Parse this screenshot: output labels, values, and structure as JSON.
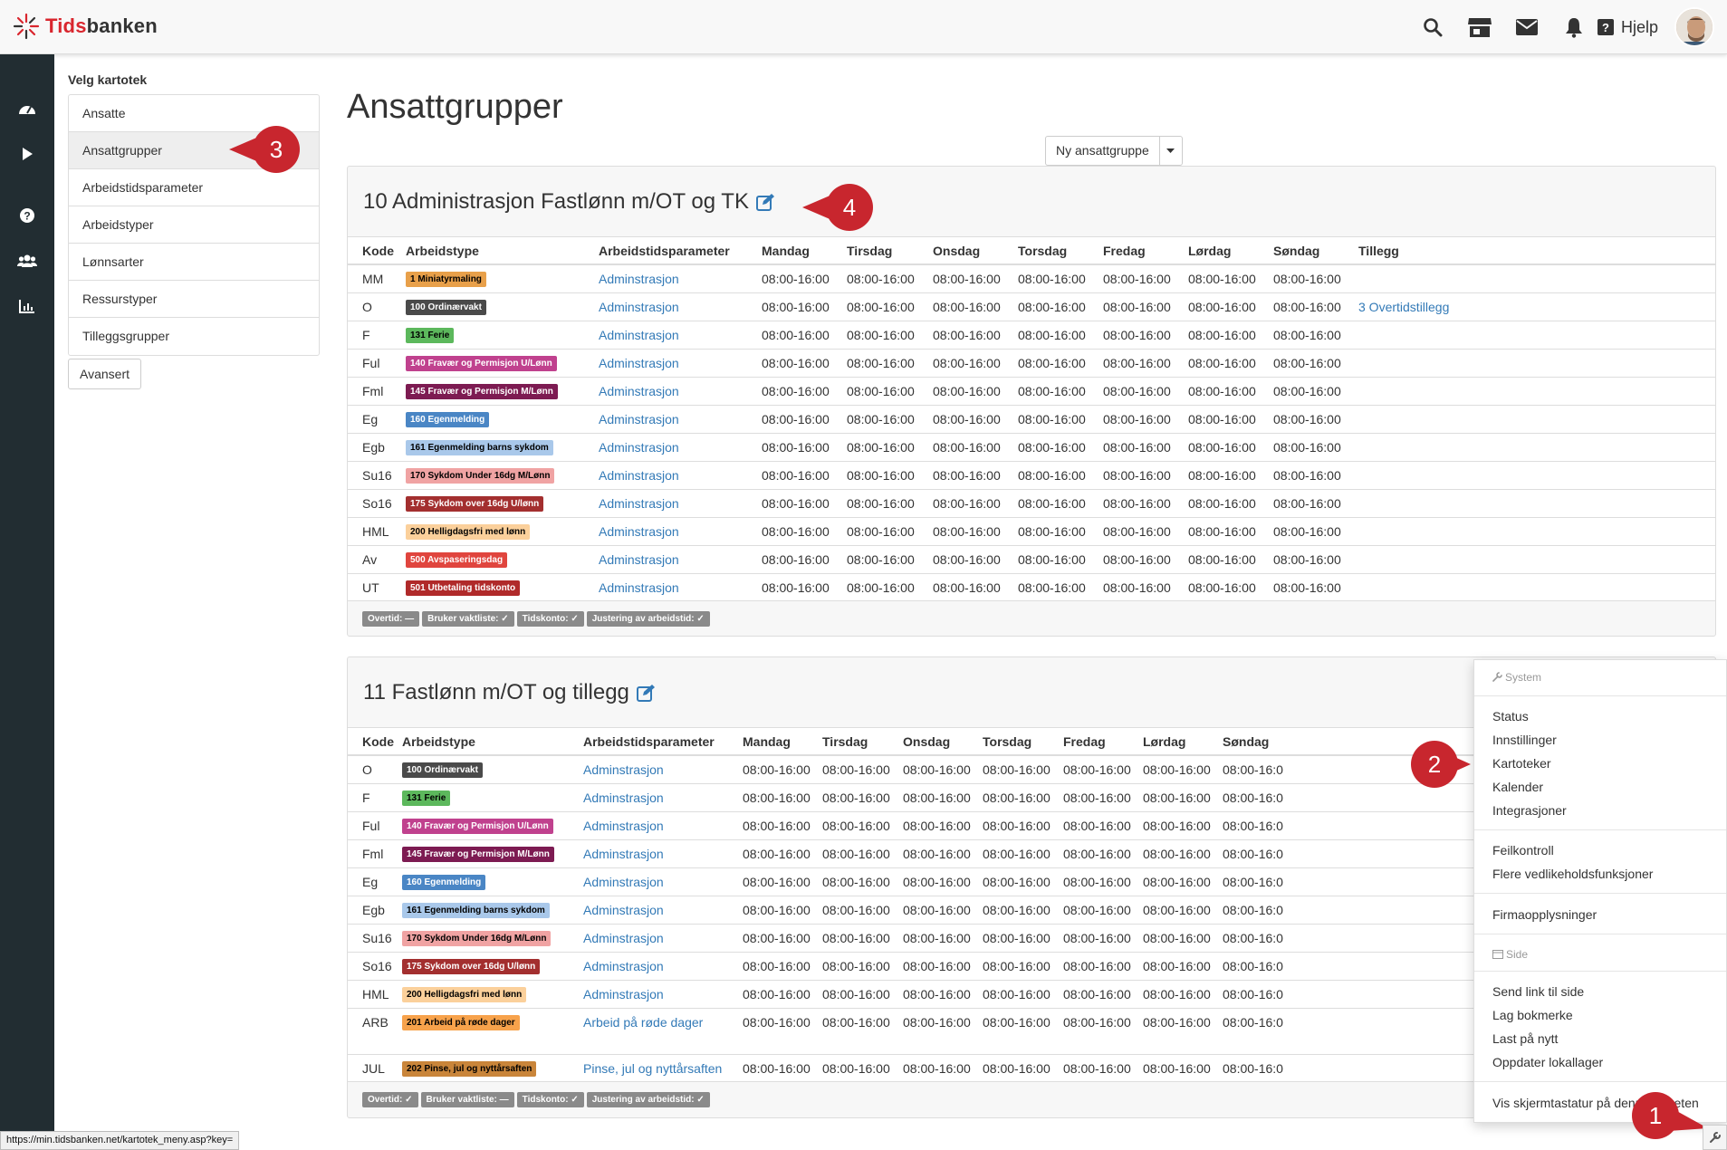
{
  "app": {
    "logo_prefix": "Tids",
    "logo_suffix": "banken"
  },
  "topbar": {
    "help_label": "Hjelp",
    "icons": [
      "search-icon",
      "store-icon",
      "mail-icon",
      "bell-icon",
      "question-icon"
    ]
  },
  "leftrail": {
    "icons": [
      "dashboard-icon",
      "play-icon",
      "help-circle-icon",
      "users-icon",
      "chart-icon"
    ]
  },
  "sidepanel": {
    "title": "Velg kartotek",
    "items": [
      "Ansatte",
      "Ansattgrupper",
      "Arbeidstidsparameter",
      "Arbeidstyper",
      "Lønnsarter",
      "Ressurstyper",
      "Tilleggsgrupper"
    ],
    "active_index": 1,
    "advanced_label": "Avansert"
  },
  "page": {
    "title": "Ansattgrupper",
    "new_button": "Ny ansattgruppe"
  },
  "headers": [
    "Kode",
    "Arbeidstype",
    "Arbeidstidsparameter",
    "Mandag",
    "Tirsdag",
    "Onsdag",
    "Torsdag",
    "Fredag",
    "Lørdag",
    "Søndag",
    "Tillegg"
  ],
  "groups": [
    {
      "title": "10 Administrasjon Fastlønn m/OT og TK",
      "rows": [
        {
          "kode": "MM",
          "type": "1 Miniatyrmaling",
          "color": "#e8a04a",
          "text": "#000",
          "param": "Adminstrasjon",
          "times": [
            "08:00-16:00",
            "08:00-16:00",
            "08:00-16:00",
            "08:00-16:00",
            "08:00-16:00",
            "08:00-16:00",
            "08:00-16:00"
          ],
          "tillegg": ""
        },
        {
          "kode": "O",
          "type": "100 Ordinærvakt",
          "color": "#4a4a4a",
          "text": "#fff",
          "param": "Adminstrasjon",
          "times": [
            "08:00-16:00",
            "08:00-16:00",
            "08:00-16:00",
            "08:00-16:00",
            "08:00-16:00",
            "08:00-16:00",
            "08:00-16:00"
          ],
          "tillegg": "3 Overtidstillegg"
        },
        {
          "kode": "F",
          "type": "131 Ferie",
          "color": "#5cb85c",
          "text": "#000",
          "param": "Adminstrasjon",
          "times": [
            "08:00-16:00",
            "08:00-16:00",
            "08:00-16:00",
            "08:00-16:00",
            "08:00-16:00",
            "08:00-16:00",
            "08:00-16:00"
          ],
          "tillegg": ""
        },
        {
          "kode": "Ful",
          "type": "140 Fravær og Permisjon U/Lønn",
          "color": "#c0418e",
          "text": "#fff",
          "param": "Adminstrasjon",
          "times": [
            "08:00-16:00",
            "08:00-16:00",
            "08:00-16:00",
            "08:00-16:00",
            "08:00-16:00",
            "08:00-16:00",
            "08:00-16:00"
          ],
          "tillegg": ""
        },
        {
          "kode": "Fml",
          "type": "145 Fravær og Permisjon M/Lønn",
          "color": "#7d1b52",
          "text": "#fff",
          "param": "Adminstrasjon",
          "times": [
            "08:00-16:00",
            "08:00-16:00",
            "08:00-16:00",
            "08:00-16:00",
            "08:00-16:00",
            "08:00-16:00",
            "08:00-16:00"
          ],
          "tillegg": ""
        },
        {
          "kode": "Eg",
          "type": "160 Egenmelding",
          "color": "#4a86c5",
          "text": "#fff",
          "param": "Adminstrasjon",
          "times": [
            "08:00-16:00",
            "08:00-16:00",
            "08:00-16:00",
            "08:00-16:00",
            "08:00-16:00",
            "08:00-16:00",
            "08:00-16:00"
          ],
          "tillegg": ""
        },
        {
          "kode": "Egb",
          "type": "161 Egenmelding barns sykdom",
          "color": "#a9c8ea",
          "text": "#000",
          "param": "Adminstrasjon",
          "times": [
            "08:00-16:00",
            "08:00-16:00",
            "08:00-16:00",
            "08:00-16:00",
            "08:00-16:00",
            "08:00-16:00",
            "08:00-16:00"
          ],
          "tillegg": ""
        },
        {
          "kode": "Su16",
          "type": "170 Sykdom Under 16dg M/Lønn",
          "color": "#f0a3a3",
          "text": "#000",
          "param": "Adminstrasjon",
          "times": [
            "08:00-16:00",
            "08:00-16:00",
            "08:00-16:00",
            "08:00-16:00",
            "08:00-16:00",
            "08:00-16:00",
            "08:00-16:00"
          ],
          "tillegg": ""
        },
        {
          "kode": "So16",
          "type": "175 Sykdom over 16dg U/lønn",
          "color": "#a32f2f",
          "text": "#fff",
          "param": "Adminstrasjon",
          "times": [
            "08:00-16:00",
            "08:00-16:00",
            "08:00-16:00",
            "08:00-16:00",
            "08:00-16:00",
            "08:00-16:00",
            "08:00-16:00"
          ],
          "tillegg": ""
        },
        {
          "kode": "HML",
          "type": "200 Helligdagsfri med lønn",
          "color": "#fbd09b",
          "text": "#000",
          "param": "Adminstrasjon",
          "times": [
            "08:00-16:00",
            "08:00-16:00",
            "08:00-16:00",
            "08:00-16:00",
            "08:00-16:00",
            "08:00-16:00",
            "08:00-16:00"
          ],
          "tillegg": ""
        },
        {
          "kode": "Av",
          "type": "500 Avspaseringsdag",
          "color": "#e0453e",
          "text": "#fff",
          "param": "Adminstrasjon",
          "times": [
            "08:00-16:00",
            "08:00-16:00",
            "08:00-16:00",
            "08:00-16:00",
            "08:00-16:00",
            "08:00-16:00",
            "08:00-16:00"
          ],
          "tillegg": ""
        },
        {
          "kode": "UT",
          "type": "501 Utbetaling tidskonto",
          "color": "#b02a2a",
          "text": "#fff",
          "param": "Adminstrasjon",
          "times": [
            "08:00-16:00",
            "08:00-16:00",
            "08:00-16:00",
            "08:00-16:00",
            "08:00-16:00",
            "08:00-16:00",
            "08:00-16:00"
          ],
          "tillegg": ""
        }
      ],
      "footer": [
        "Overtid: —",
        "Bruker vaktliste: ✓",
        "Tidskonto: ✓",
        "Justering av arbeidstid: ✓"
      ]
    },
    {
      "title": "11 Fastlønn m/OT og tillegg",
      "rows": [
        {
          "kode": "O",
          "type": "100 Ordinærvakt",
          "color": "#4a4a4a",
          "text": "#fff",
          "param": "Adminstrasjon",
          "times": [
            "08:00-16:00",
            "08:00-16:00",
            "08:00-16:00",
            "08:00-16:00",
            "08:00-16:00",
            "08:00-16:00",
            "08:00-16:0"
          ]
        },
        {
          "kode": "F",
          "type": "131 Ferie",
          "color": "#5cb85c",
          "text": "#000",
          "param": "Adminstrasjon",
          "times": [
            "08:00-16:00",
            "08:00-16:00",
            "08:00-16:00",
            "08:00-16:00",
            "08:00-16:00",
            "08:00-16:00",
            "08:00-16:0"
          ]
        },
        {
          "kode": "Ful",
          "type": "140 Fravær og Permisjon U/Lønn",
          "color": "#c0418e",
          "text": "#fff",
          "param": "Adminstrasjon",
          "times": [
            "08:00-16:00",
            "08:00-16:00",
            "08:00-16:00",
            "08:00-16:00",
            "08:00-16:00",
            "08:00-16:00",
            "08:00-16:0"
          ]
        },
        {
          "kode": "Fml",
          "type": "145 Fravær og Permisjon M/Lønn",
          "color": "#7d1b52",
          "text": "#fff",
          "param": "Adminstrasjon",
          "times": [
            "08:00-16:00",
            "08:00-16:00",
            "08:00-16:00",
            "08:00-16:00",
            "08:00-16:00",
            "08:00-16:00",
            "08:00-16:0"
          ]
        },
        {
          "kode": "Eg",
          "type": "160 Egenmelding",
          "color": "#4a86c5",
          "text": "#fff",
          "param": "Adminstrasjon",
          "times": [
            "08:00-16:00",
            "08:00-16:00",
            "08:00-16:00",
            "08:00-16:00",
            "08:00-16:00",
            "08:00-16:00",
            "08:00-16:0"
          ]
        },
        {
          "kode": "Egb",
          "type": "161 Egenmelding barns sykdom",
          "color": "#a9c8ea",
          "text": "#000",
          "param": "Adminstrasjon",
          "times": [
            "08:00-16:00",
            "08:00-16:00",
            "08:00-16:00",
            "08:00-16:00",
            "08:00-16:00",
            "08:00-16:00",
            "08:00-16:0"
          ]
        },
        {
          "kode": "Su16",
          "type": "170 Sykdom Under 16dg M/Lønn",
          "color": "#f0a3a3",
          "text": "#000",
          "param": "Adminstrasjon",
          "times": [
            "08:00-16:00",
            "08:00-16:00",
            "08:00-16:00",
            "08:00-16:00",
            "08:00-16:00",
            "08:00-16:00",
            "08:00-16:0"
          ]
        },
        {
          "kode": "So16",
          "type": "175 Sykdom over 16dg U/lønn",
          "color": "#a32f2f",
          "text": "#fff",
          "param": "Adminstrasjon",
          "times": [
            "08:00-16:00",
            "08:00-16:00",
            "08:00-16:00",
            "08:00-16:00",
            "08:00-16:00",
            "08:00-16:00",
            "08:00-16:0"
          ]
        },
        {
          "kode": "HML",
          "type": "200 Helligdagsfri med lønn",
          "color": "#fbd09b",
          "text": "#000",
          "param": "Adminstrasjon",
          "times": [
            "08:00-16:00",
            "08:00-16:00",
            "08:00-16:00",
            "08:00-16:00",
            "08:00-16:00",
            "08:00-16:00",
            "08:00-16:0"
          ]
        },
        {
          "kode": "ARB",
          "type": "201 Arbeid på røde dager",
          "color": "#f7a24b",
          "text": "#000",
          "param": "Arbeid på røde dager",
          "times": [
            "08:00-16:00",
            "08:00-16:00",
            "08:00-16:00",
            "08:00-16:00",
            "08:00-16:00",
            "08:00-16:00",
            "08:00-16:0"
          ]
        },
        {
          "kode": "JUL",
          "type": "202 Pinse, jul og nyttårsaften",
          "color": "#c9853a",
          "text": "#000",
          "param": "Pinse, jul og nyttårsaften",
          "times": [
            "08:00-16:00",
            "08:00-16:00",
            "08:00-16:00",
            "08:00-16:00",
            "08:00-16:00",
            "08:00-16:00",
            "08:00-16:0"
          ]
        }
      ],
      "footer": [
        "Overtid: ✓",
        "Bruker vaktliste: —",
        "Tidskonto: ✓",
        "Justering av arbeidstid: ✓"
      ]
    }
  ],
  "context_menu": {
    "system_header": "System",
    "system_items": [
      "Status",
      "Innstillinger",
      "Kartoteker",
      "Kalender",
      "Integrasjoner"
    ],
    "maint_items": [
      "Feilkontroll",
      "Flere vedlikeholdsfunksjoner"
    ],
    "company_items": [
      "Firmaopplysninger"
    ],
    "side_header": "Side",
    "side_items": [
      "Send link til side",
      "Lag bokmerke",
      "Last på nytt",
      "Oppdater lokallager"
    ],
    "last_item": "Vis skjermtastatur på denne enheten"
  },
  "callouts": [
    "1",
    "2",
    "3",
    "4"
  ],
  "status_url": "https://min.tidsbanken.net/kartotek_meny.asp?key="
}
